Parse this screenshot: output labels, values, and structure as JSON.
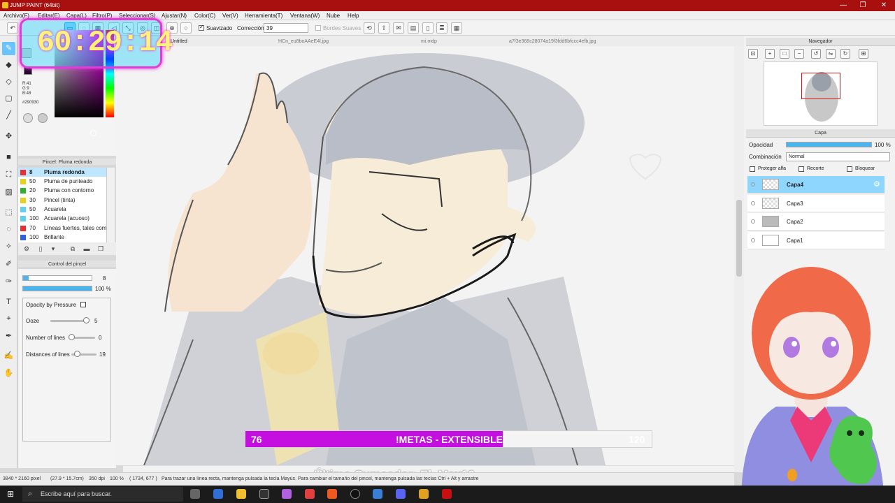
{
  "window": {
    "title": "JUMP PAINT (64bit)",
    "controls": [
      "—",
      "❐",
      "✕"
    ]
  },
  "menu": [
    "Archivo(F)",
    "Editar(E)",
    "Capa(L)",
    "Filtro(P)",
    "Seleccionar(S)",
    "Ajustar(N)",
    "Color(C)",
    "Ver(V)",
    "Herramienta(T)",
    "Ventana(W)",
    "Nube",
    "Help"
  ],
  "toolbar": {
    "suavizado_label": "Suavizado",
    "correccion_label": "Corrección",
    "correccion_value": "39",
    "bordes_label": "Bordes Suaves"
  },
  "timer": "60:29:14",
  "color": {
    "r": "R:41",
    "g": "G:9",
    "b": "B:48",
    "hex": "#290930",
    "current": "#290930"
  },
  "brush_panel": {
    "title": "Pincel: Pluma redonda",
    "items": [
      {
        "size": "8",
        "name": "Pluma redonda",
        "color": "#e83030"
      },
      {
        "size": "50",
        "name": "Pluma de punteado",
        "color": "#e8d020"
      },
      {
        "size": "20",
        "name": "Pluma con contorno",
        "color": "#30b030"
      },
      {
        "size": "30",
        "name": "Pincel (tinta)",
        "color": "#e8d020"
      },
      {
        "size": "50",
        "name": "Acuarela",
        "color": "#60d0f0"
      },
      {
        "size": "100",
        "name": "Acuarela (acuoso)",
        "color": "#60d0f0"
      },
      {
        "size": "70",
        "name": "Líneas fuertes, tales como",
        "color": "#e83030"
      },
      {
        "size": "100",
        "name": "Brillante",
        "color": "#3060e0"
      }
    ]
  },
  "brush_control": {
    "title": "Control del pincel",
    "size_value": "8",
    "opacity_value": "100 %",
    "opacity_fraction": 1.0,
    "opacity_by_pressure": "Opacity by Pressure",
    "ooze_label": "Ooze",
    "ooze_value": "5",
    "lines_label": "Number of lines",
    "lines_value": "0",
    "distances_label": "Distances of lines",
    "distances_value": "19"
  },
  "tabs": [
    "Untitled",
    "HCn_eu8boAAeE4l.jpg",
    "mi.mdp",
    "a7f3e368c28074a19f3fdd6bfccc4efb.jpg"
  ],
  "goal": {
    "current": "76",
    "label": "!METAS - EXTENSIBLE",
    "target": "120",
    "fraction": 0.633
  },
  "last_cumeador": "Último Cumeador: El_Max16",
  "status": {
    "size": "3840 * 2160 pixel",
    "dims": "(27.9 * 15.7cm)",
    "dpi": "350 dpi",
    "zoom": "100 %",
    "coords": "( 1734, 677 )",
    "hint": "Para trazar una línea recta, mantenga pulsada la tecla Mayús. Para cambiar el tamaño del pincel, mantenga pulsada las teclas Ctrl + Alt y arrastre"
  },
  "navigator": {
    "title": "Navegador"
  },
  "layers_panel": {
    "title": "Capa",
    "opacity_label": "Opacidad",
    "opacity_value": "100 %",
    "opacity_fraction": 1.0,
    "blend_label": "Combinación",
    "blend_value": "Normal",
    "protect_alpha": "Proteger alfa",
    "clip": "Recorte",
    "lock": "Bloquear",
    "layers": [
      "Capa4",
      "Capa3",
      "Capa2",
      "Capa1"
    ]
  },
  "taskbar": {
    "search_placeholder": "Escribe aquí para buscar."
  }
}
